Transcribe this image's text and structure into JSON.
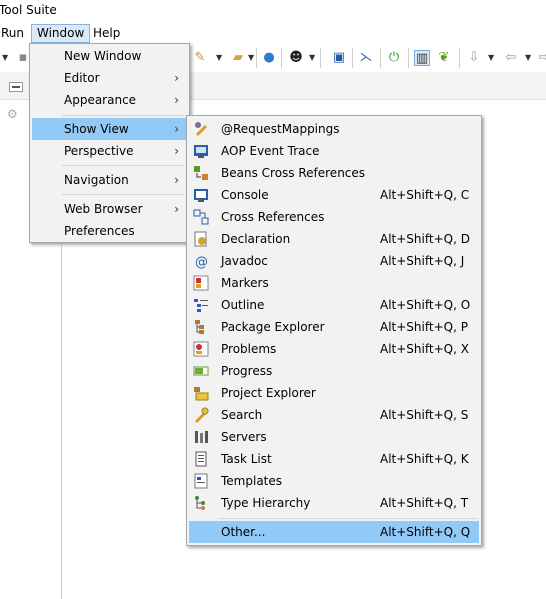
{
  "title": "Tool Suite",
  "menubar": {
    "run": "Run",
    "window": "Window",
    "help": "Help"
  },
  "window_menu": {
    "new_window": "New Window",
    "editor": "Editor",
    "appearance": "Appearance",
    "show_view": "Show View",
    "perspective": "Perspective",
    "navigation": "Navigation",
    "web_browser": "Web Browser",
    "preferences": "Preferences",
    "submenu_arrow": "›"
  },
  "show_view_menu": {
    "items": [
      {
        "label": "@RequestMappings",
        "shortcut": ""
      },
      {
        "label": "AOP Event Trace",
        "shortcut": ""
      },
      {
        "label": "Beans Cross References",
        "shortcut": ""
      },
      {
        "label": "Console",
        "shortcut": "Alt+Shift+Q, C"
      },
      {
        "label": "Cross References",
        "shortcut": ""
      },
      {
        "label": "Declaration",
        "shortcut": "Alt+Shift+Q, D"
      },
      {
        "label": "Javadoc",
        "shortcut": "Alt+Shift+Q, J"
      },
      {
        "label": "Markers",
        "shortcut": ""
      },
      {
        "label": "Outline",
        "shortcut": "Alt+Shift+Q, O"
      },
      {
        "label": "Package Explorer",
        "shortcut": "Alt+Shift+Q, P"
      },
      {
        "label": "Problems",
        "shortcut": "Alt+Shift+Q, X"
      },
      {
        "label": "Progress",
        "shortcut": ""
      },
      {
        "label": "Project Explorer",
        "shortcut": ""
      },
      {
        "label": "Search",
        "shortcut": "Alt+Shift+Q, S"
      },
      {
        "label": "Servers",
        "shortcut": ""
      },
      {
        "label": "Task List",
        "shortcut": "Alt+Shift+Q, K"
      },
      {
        "label": "Templates",
        "shortcut": ""
      },
      {
        "label": "Type Hierarchy",
        "shortcut": "Alt+Shift+Q, T"
      }
    ],
    "other": {
      "label": "Other...",
      "shortcut": "Alt+Shift+Q, Q"
    }
  },
  "colors": {
    "menu_bg": "#f2f2f2",
    "highlight": "#91c9f7",
    "window_menu_active": "#d9e9f7"
  },
  "icons": {
    "toolbar": [
      "back-icon",
      "pencil-icon",
      "folder-icon",
      "globe-icon",
      "person-icon",
      "monitor-icon",
      "debug-icon",
      "power-icon",
      "split-icon",
      "spring-icon",
      "download-icon",
      "nav-icon",
      "arrow-icon"
    ],
    "views": [
      "request-mappings-icon",
      "aop-trace-icon",
      "beans-crossref-icon",
      "console-icon",
      "cross-references-icon",
      "declaration-icon",
      "javadoc-icon",
      "markers-icon",
      "outline-icon",
      "package-explorer-icon",
      "problems-icon",
      "progress-icon",
      "project-explorer-icon",
      "search-icon",
      "servers-icon",
      "task-list-icon",
      "templates-icon",
      "type-hierarchy-icon"
    ]
  }
}
